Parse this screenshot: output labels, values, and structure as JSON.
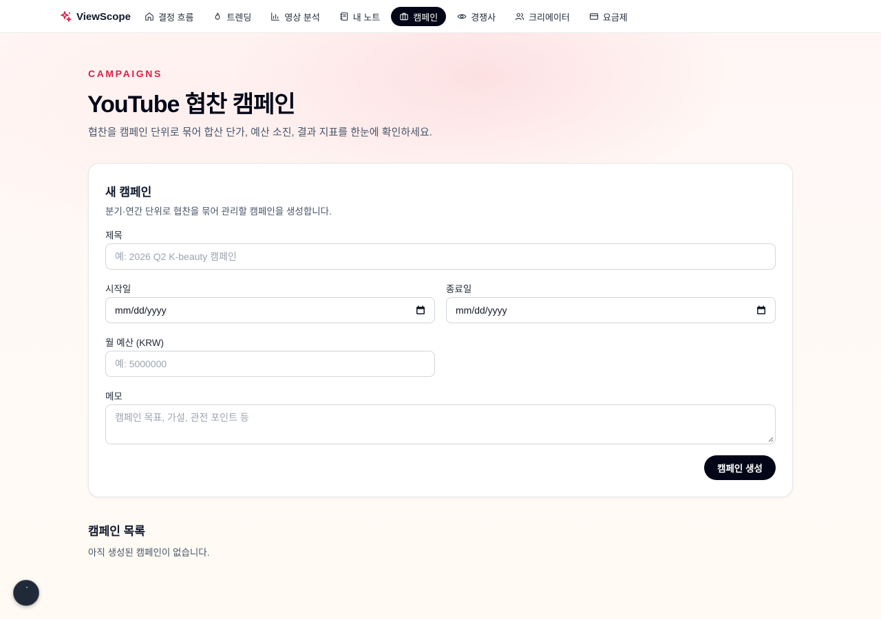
{
  "nav": {
    "brand": "ViewScope",
    "items": [
      {
        "label": "결정 흐름",
        "icon": "home-icon",
        "active": false
      },
      {
        "label": "트렌딩",
        "icon": "flame-icon",
        "active": false
      },
      {
        "label": "영상 분석",
        "icon": "bar-chart-icon",
        "active": false
      },
      {
        "label": "내 노트",
        "icon": "notebook-icon",
        "active": false
      },
      {
        "label": "캠페인",
        "icon": "briefcase-icon",
        "active": true
      },
      {
        "label": "경쟁사",
        "icon": "eye-icon",
        "active": false
      },
      {
        "label": "크리에이터",
        "icon": "users-icon",
        "active": false
      },
      {
        "label": "요금제",
        "icon": "credit-card-icon",
        "active": false
      }
    ]
  },
  "hero": {
    "eyebrow": "CAMPAIGNS",
    "title": "YouTube 협찬 캠페인",
    "subtitle": "협찬을 캠페인 단위로 묶어 합산 단가, 예산 소진, 결과 지표를 한눈에 확인하세요."
  },
  "form": {
    "title": "새 캠페인",
    "subtitle": "분기·연간 단위로 협찬을 묶어 관리할 캠페인을 생성합니다.",
    "title_label": "제목",
    "title_placeholder": "예: 2026 Q2 K-beauty 캠페인",
    "start_label": "시작일",
    "start_value": "mm/dd/yyyy",
    "end_label": "종료일",
    "end_value": "mm/dd/yyyy",
    "budget_label": "월 예산 (KRW)",
    "budget_placeholder": "예: 5000000",
    "memo_label": "메모",
    "memo_placeholder": "캠페인 목표, 가설, 관전 포인트 등",
    "submit_label": "캠페인 생성"
  },
  "list": {
    "title": "캠페인 목록",
    "empty": "아직 생성된 캠페인이 없습니다."
  },
  "colors": {
    "accent": "#e11d48",
    "primary": "#020617"
  }
}
